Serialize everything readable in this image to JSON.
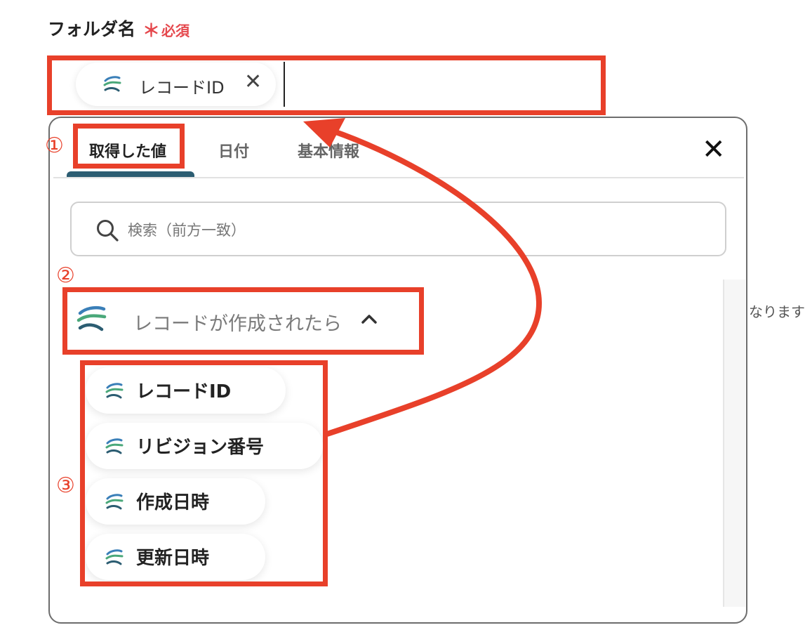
{
  "field": {
    "label": "フォルダ名",
    "required_mark": "＊",
    "required_text": "必須"
  },
  "input": {
    "chip_label": "レコードID",
    "chip_remove_glyph": "✕"
  },
  "panel": {
    "close_glyph": "✕",
    "tabs": [
      {
        "label": "取得した値",
        "active": true
      },
      {
        "label": "日付",
        "active": false
      },
      {
        "label": "基本情報",
        "active": false
      }
    ],
    "search_placeholder": "検索（前方一致）"
  },
  "group": {
    "label": "レコードが作成されたら",
    "expanded": true
  },
  "items": [
    {
      "label": "レコードID"
    },
    {
      "label": "リビジョン番号"
    },
    {
      "label": "作成日時"
    },
    {
      "label": "更新日時"
    }
  ],
  "background_text": "なります",
  "annotations": [
    "①",
    "②",
    "③"
  ],
  "colors": {
    "annotation_red": "#e8402a",
    "required_red": "#e5484d",
    "tab_underline": "#2c5d72",
    "icon_blue": "#3a7fb8",
    "icon_green": "#4aa87a"
  },
  "icons": {
    "app_icon": "kintone-swirl-icon",
    "search": "search-icon",
    "collapse": "chevron-up-icon",
    "close": "close-icon"
  }
}
